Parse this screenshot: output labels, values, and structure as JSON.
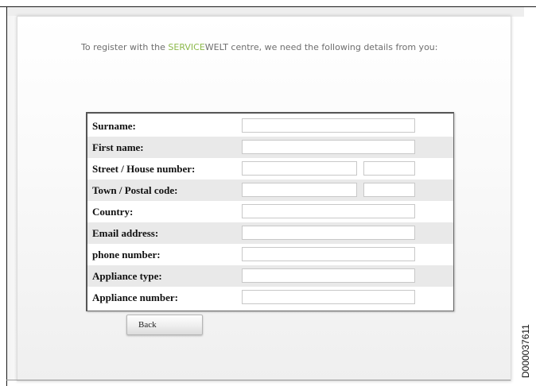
{
  "intro": {
    "prefix": "To register with the ",
    "brand_part1": "SERVICE",
    "brand_part2": "WELT",
    "suffix": " centre, we need the following details from you:"
  },
  "colors": {
    "brand_green": "#8cb94a",
    "row_shade": "#e9e9e9"
  },
  "form": {
    "fields": [
      {
        "label": "Surname:",
        "value": ""
      },
      {
        "label": "First name:",
        "value": ""
      },
      {
        "label": "Street / House number:",
        "value": "",
        "value2": ""
      },
      {
        "label": "Town / Postal code:",
        "value": "",
        "value2": ""
      },
      {
        "label": "Country:",
        "value": ""
      },
      {
        "label": "Email address:",
        "value": ""
      },
      {
        "label": "phone number:",
        "value": ""
      },
      {
        "label": "Appliance type:",
        "value": ""
      },
      {
        "label": "Appliance number:",
        "value": ""
      }
    ]
  },
  "buttons": {
    "back_label": "Back"
  },
  "document_id": "D000037611"
}
